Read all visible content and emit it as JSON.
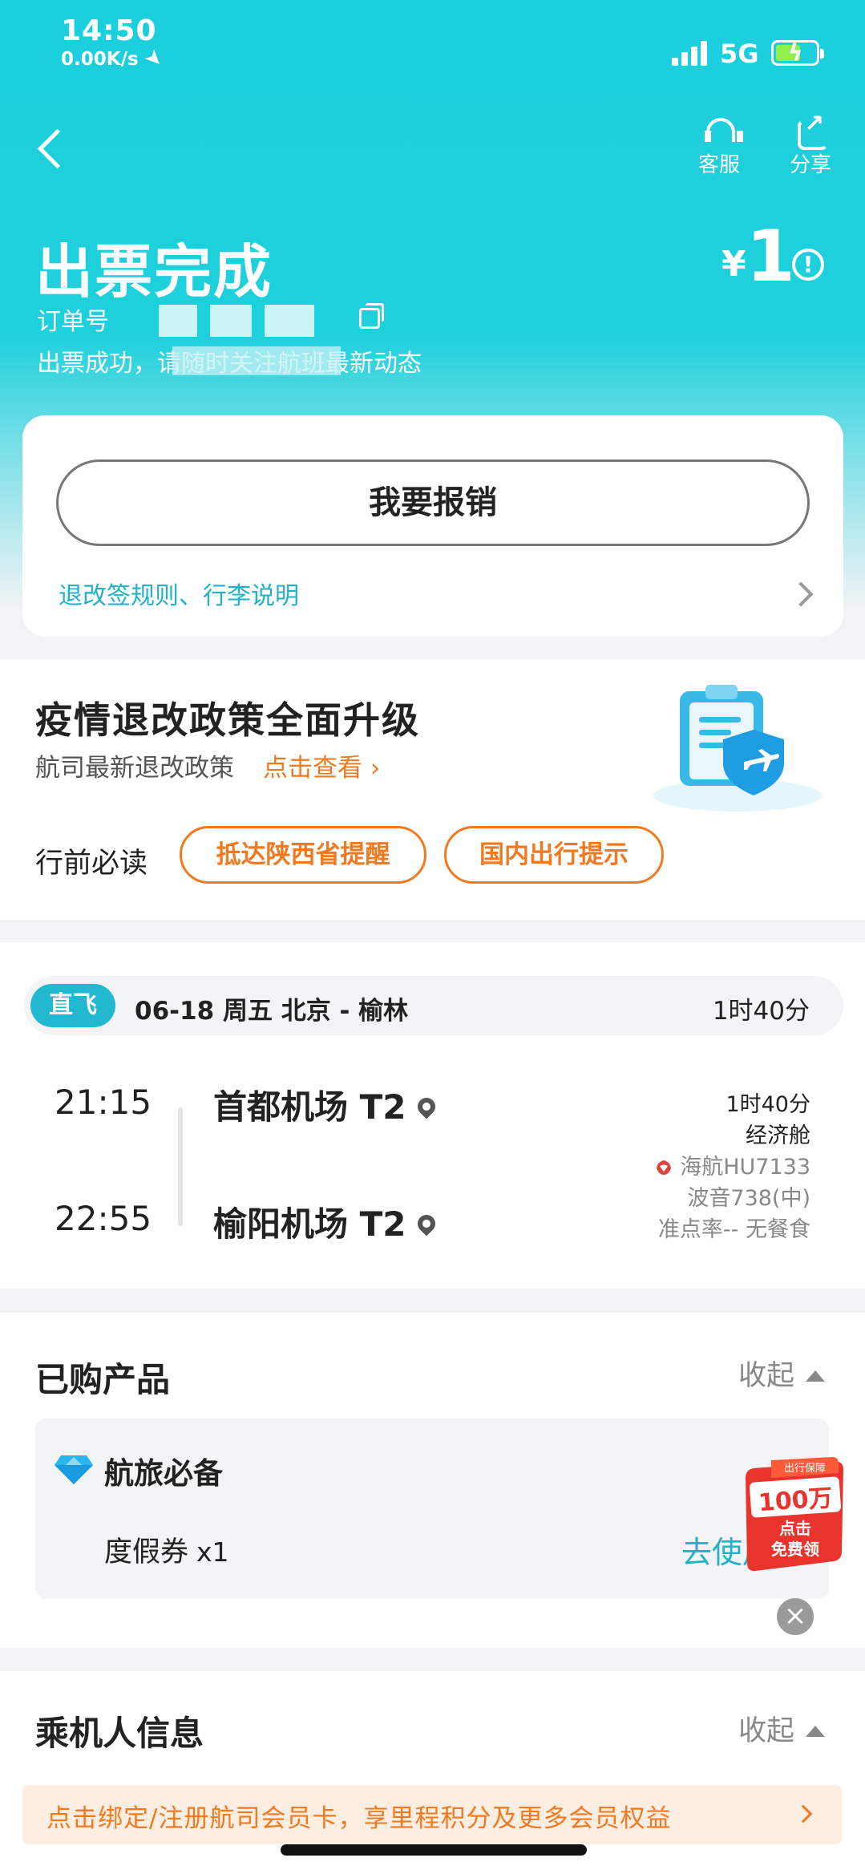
{
  "status_bar": {
    "time": "14:50",
    "net_speed": "0.00K/s",
    "network": "5G"
  },
  "header": {
    "service_label": "客服",
    "share_label": "分享",
    "title": "出票完成",
    "order_label": "订单号",
    "status_message": "出票成功，请随时关注航班最新动态",
    "price_currency": "¥",
    "price_amount": "1",
    "info_glyph": "!"
  },
  "reimburse": {
    "button_label": "我要报销",
    "rules_link": "退改签规则、行李说明"
  },
  "policy": {
    "title": "疫情退改政策全面升级",
    "subtitle": "航司最新退改政策",
    "link": "点击查看 ›",
    "pre_travel_label": "行前必读",
    "tags": [
      "抵达陕西省提醒",
      "国内出行提示"
    ]
  },
  "flight": {
    "tag": "直飞",
    "date_route": "06-18  周五  北京 - 榆林",
    "duration": "1时40分",
    "departure_time": "21:15",
    "arrival_time": "22:55",
    "departure_airport": "首都机场 T2",
    "arrival_airport": "榆阳机场 T2",
    "info": {
      "duration": "1时40分",
      "cabin": "经济舱",
      "airline_flight": "海航HU7133",
      "aircraft": "波音738(中)",
      "punctuality_meal": "准点率-- 无餐食"
    }
  },
  "products": {
    "title": "已购产品",
    "collapse_label": "收起",
    "group_name": "航旅必备",
    "item_name": "度假券",
    "item_qty": "x1",
    "use_link": "去使用",
    "promo_badge": {
      "top": "出行保障",
      "amount": "100万",
      "line1": "点击",
      "line2": "免费领"
    },
    "close_glyph": "×"
  },
  "passenger": {
    "title": "乘机人信息",
    "collapse_label": "收起",
    "member_banner": "点击绑定/注册航司会员卡，享里程积分及更多会员权益"
  },
  "colors": {
    "brand_teal": "#1ccfdc",
    "accent_orange": "#f07a22",
    "link_teal": "#22b2c8"
  }
}
